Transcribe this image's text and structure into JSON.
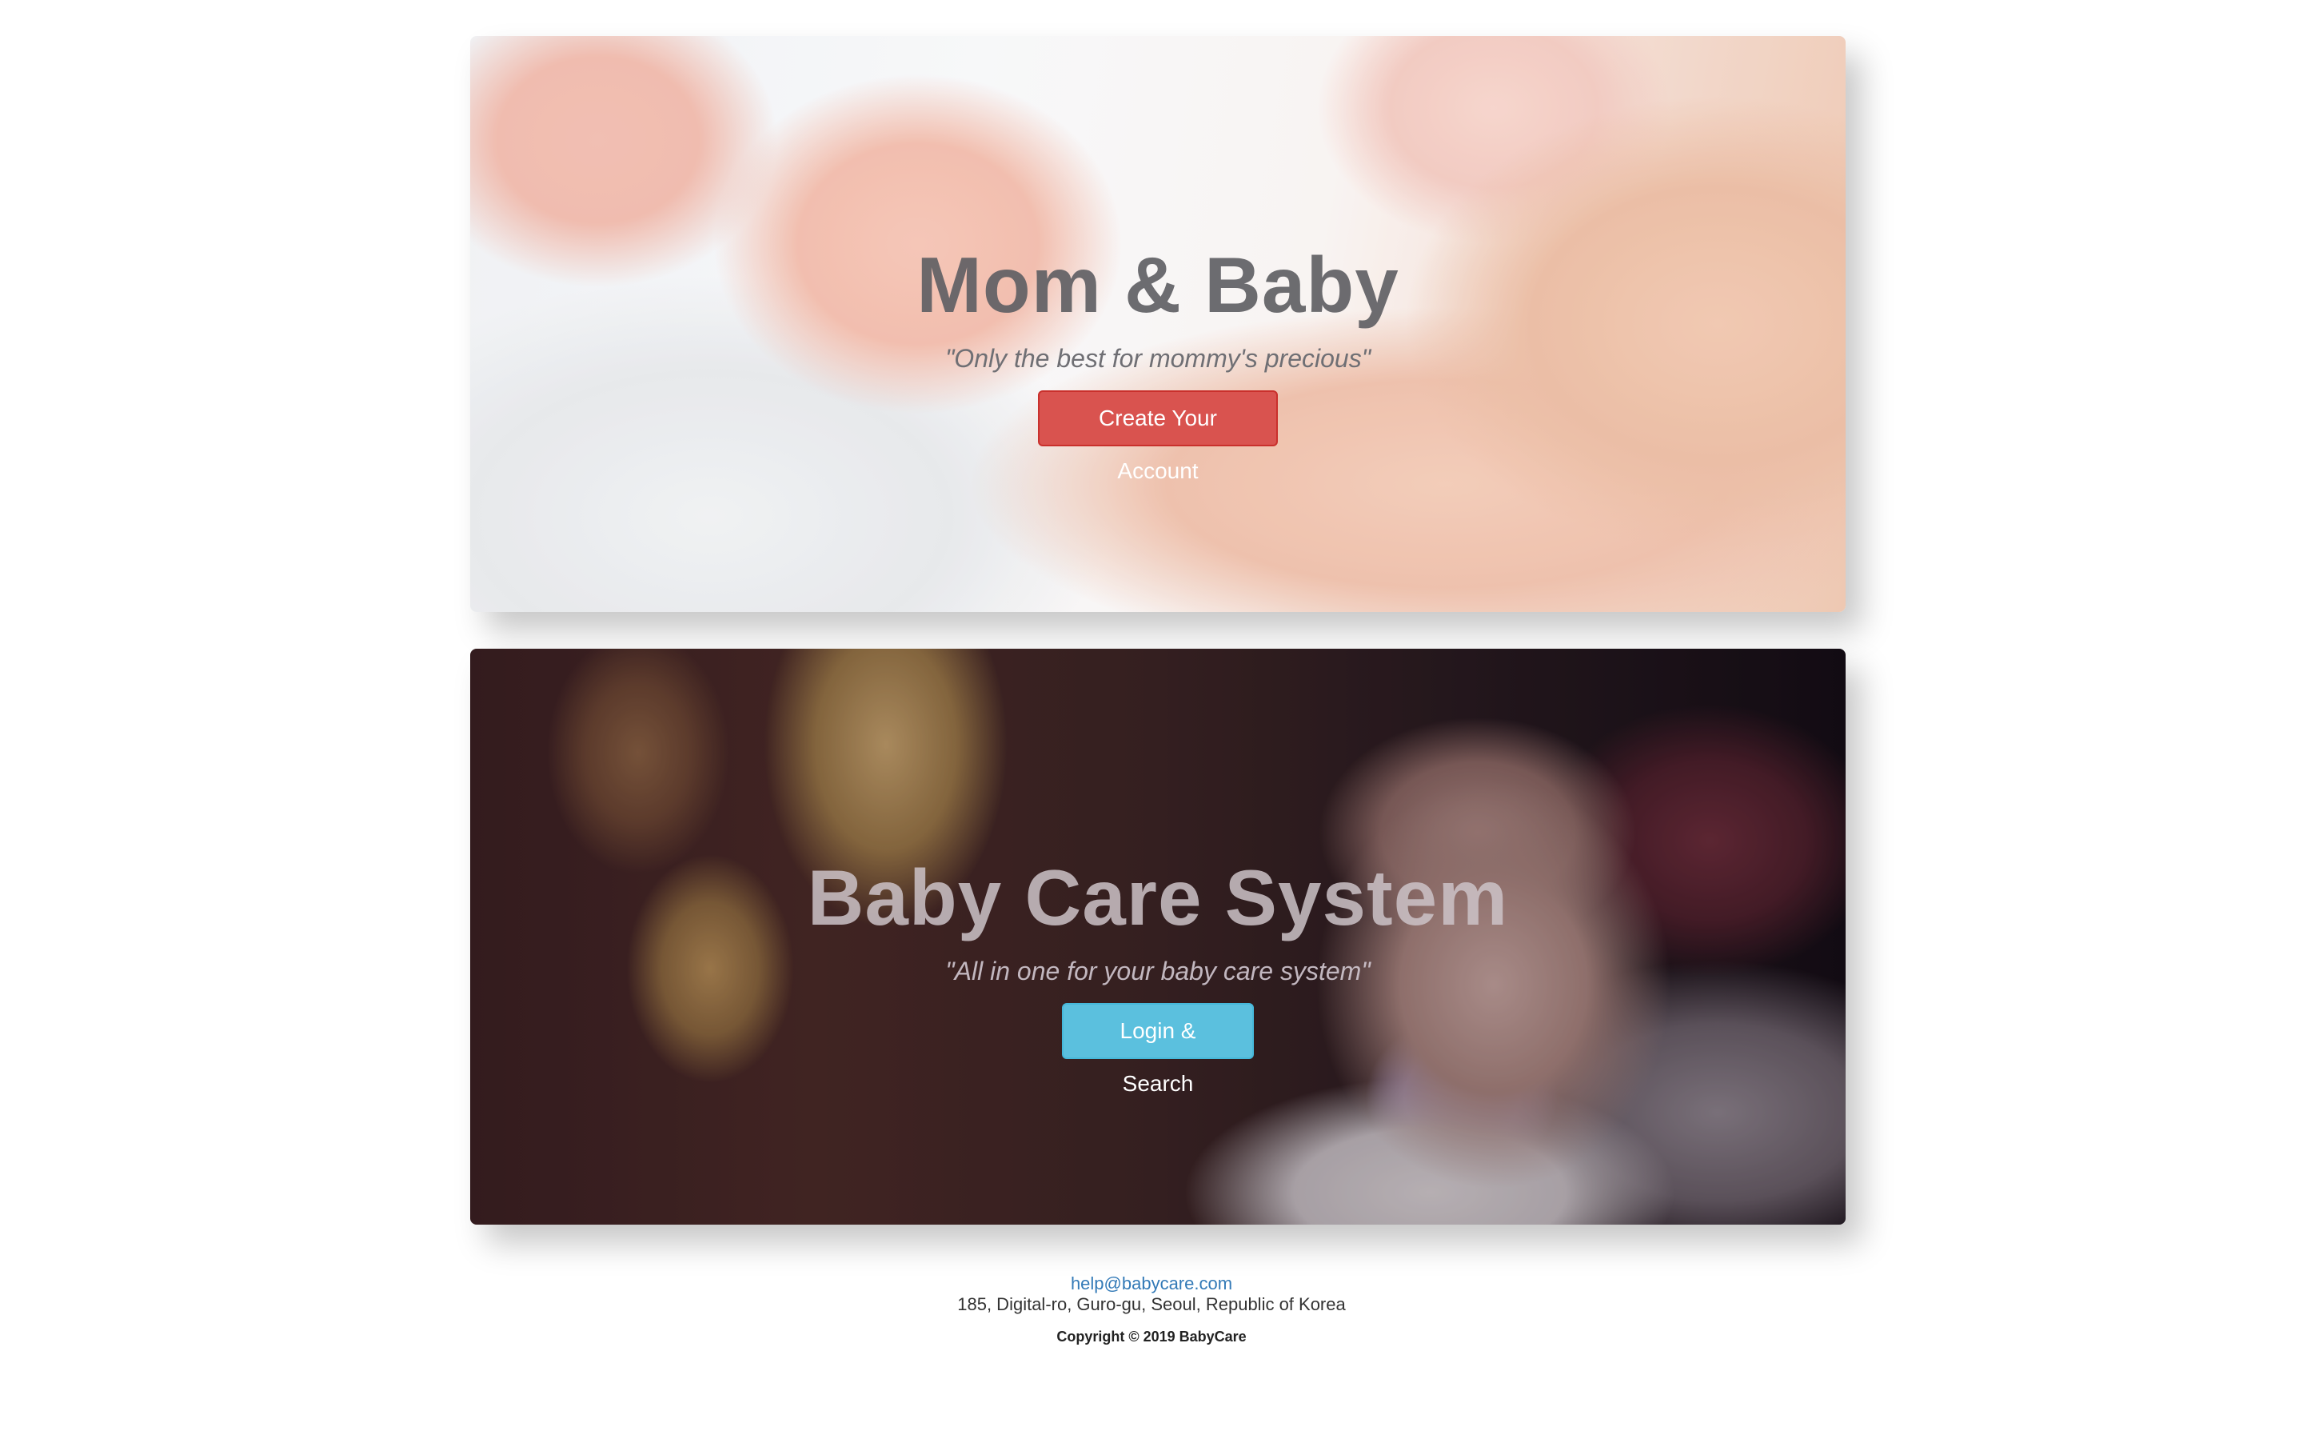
{
  "hero_primary": {
    "title": "Mom & Baby",
    "tagline": "\"Only the best for mommy's precious\"",
    "button_label": "Create Your Account",
    "button_color": "#d9534f"
  },
  "hero_secondary": {
    "title": "Baby Care System",
    "tagline": "\"All in one for your baby care system\"",
    "button_label": "Login & Search",
    "button_color": "#5bc0de"
  },
  "footer": {
    "email": "help@babycare.com",
    "address": "185, Digital-ro, Guro-gu, Seoul, Republic of Korea",
    "copyright": "Copyright © 2019 BabyCare"
  },
  "colors": {
    "link": "#337ab7",
    "danger": "#d9534f",
    "info": "#5bc0de"
  }
}
